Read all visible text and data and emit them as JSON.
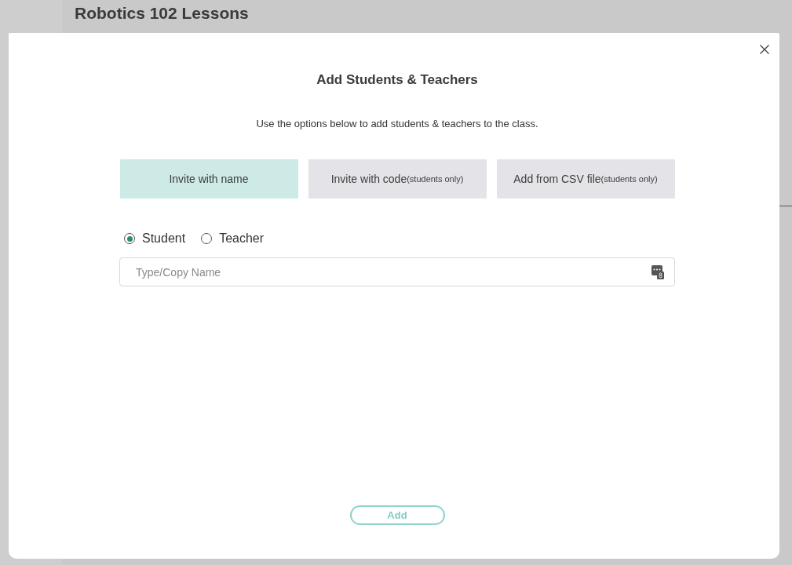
{
  "page": {
    "title": "Robotics 102 Lessons"
  },
  "dialog": {
    "title": "Add Students & Teachers",
    "description": "Use the options below to add students & teachers to the class.",
    "tabs": [
      {
        "label": "Invite with name",
        "selected": true
      },
      {
        "label": "Invite with code",
        "note": "(students only)",
        "selected": false
      },
      {
        "label": "Add from CSV file",
        "note": "(students only)",
        "selected": false
      }
    ],
    "roles": [
      {
        "label": "Student",
        "selected": true
      },
      {
        "label": "Teacher",
        "selected": false
      }
    ],
    "name_field": {
      "placeholder": "Type/Copy Name"
    },
    "add_button": {
      "label": "Add"
    }
  }
}
